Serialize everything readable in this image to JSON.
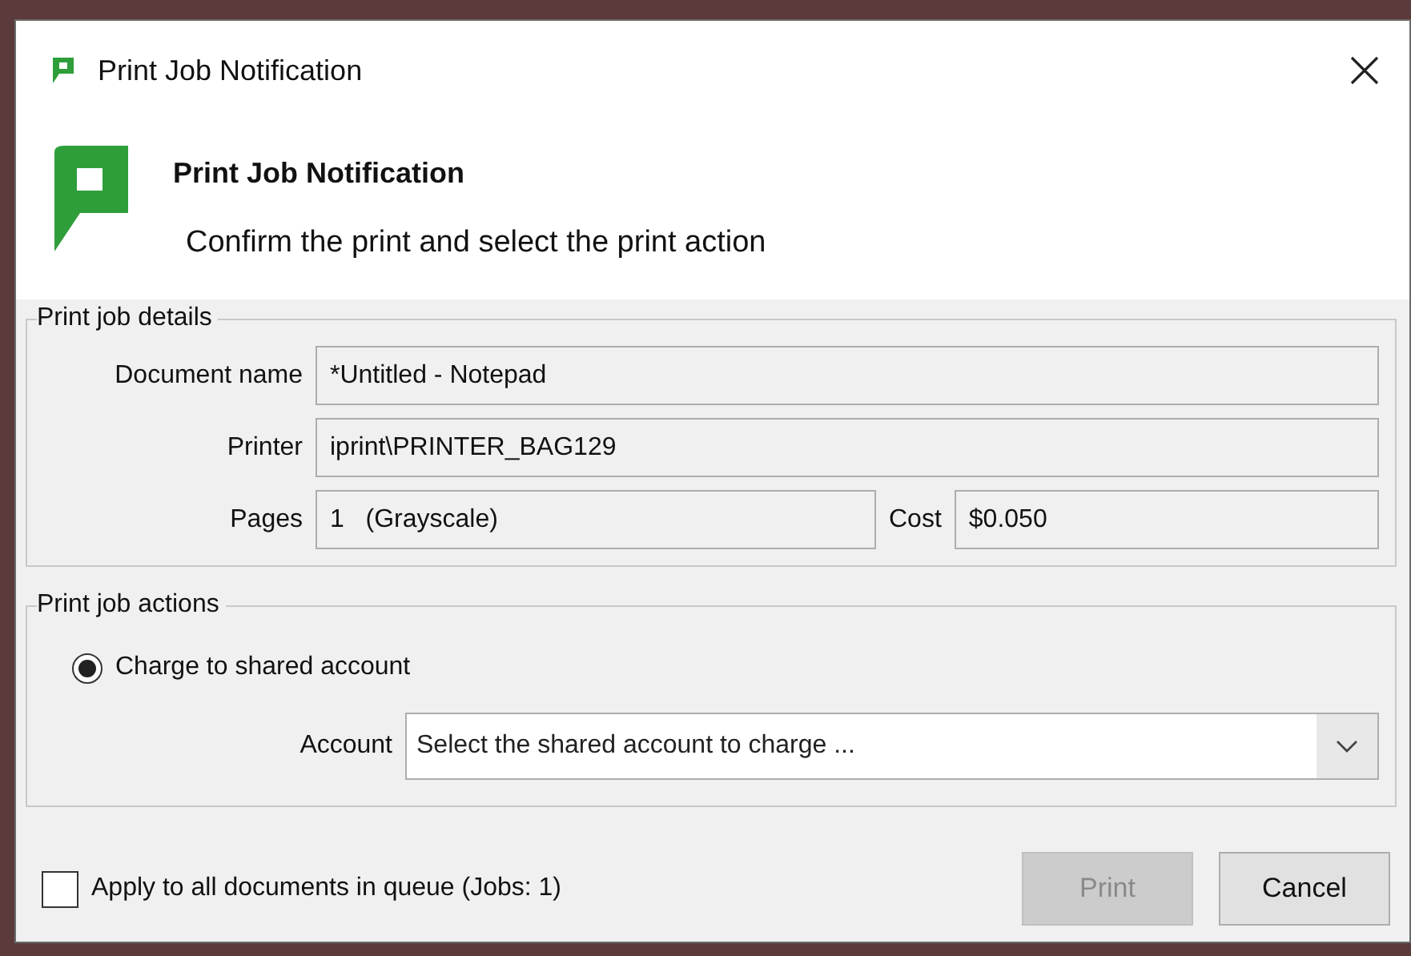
{
  "window": {
    "title": "Print Job Notification"
  },
  "header": {
    "title": "Print Job Notification",
    "subtitle": "Confirm the print and select the print action"
  },
  "details": {
    "legend": "Print job details",
    "fields": [
      {
        "label": "Document name",
        "value": "*Untitled - Notepad"
      },
      {
        "label": "Printer",
        "value": "iprint\\PRINTER_BAG129"
      }
    ],
    "pages": {
      "label": "Pages",
      "value": "1   (Grayscale)"
    },
    "cost": {
      "label": "Cost",
      "value": "$0.050"
    }
  },
  "actions": {
    "legend": "Print job actions",
    "options": [
      {
        "label": "Charge to shared account",
        "selected": true
      }
    ],
    "account": {
      "label": "Account",
      "placeholder": "Select the shared account to charge ..."
    }
  },
  "apply_all": {
    "label": "Apply to all documents in queue (Jobs: 1)",
    "checked": false
  },
  "buttons": [
    {
      "label": "Print",
      "disabled": true
    },
    {
      "label": "Cancel",
      "disabled": false
    }
  ]
}
